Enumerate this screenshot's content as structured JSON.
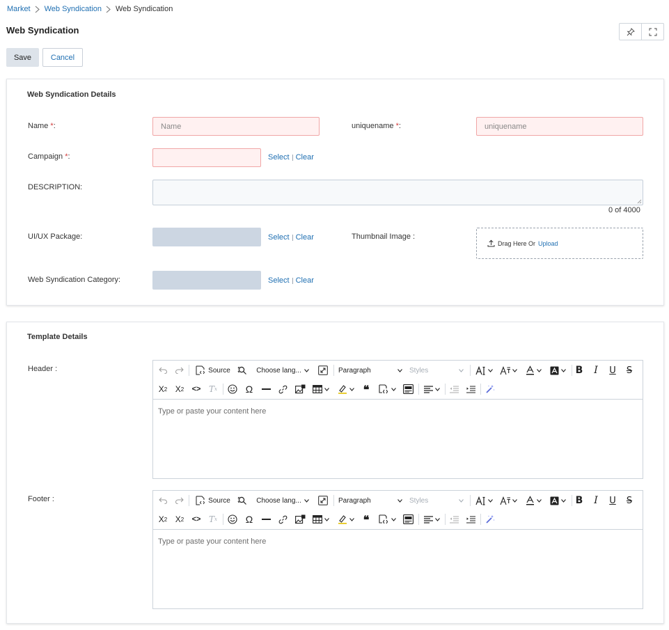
{
  "breadcrumb": {
    "items": [
      "Market",
      "Web Syndication"
    ],
    "current": "Web Syndication"
  },
  "page": {
    "title": "Web Syndication"
  },
  "header_icons": [
    "pin-icon",
    "fullscreen-icon"
  ],
  "actions": {
    "save_label": "Save",
    "cancel_label": "Cancel"
  },
  "details": {
    "title": "Web Syndication Details",
    "required_mark": "*",
    "name": {
      "label": "Name ",
      "suffix": ":",
      "placeholder": "Name"
    },
    "uniquename": {
      "label": "uniquename ",
      "suffix": ":",
      "placeholder": "uniquename"
    },
    "campaign": {
      "label": "Campaign ",
      "suffix": ":"
    },
    "description": {
      "label": "DESCRIPTION:",
      "counter": "0 of 4000"
    },
    "uiux_package": {
      "label": "UI/UX Package:"
    },
    "thumbnail": {
      "label": "Thumbnail Image :",
      "drag_text": "Drag Here Or",
      "upload_label": "Upload"
    },
    "category": {
      "label": "Web Syndication Category:"
    },
    "select_label": "Select",
    "clear_label": "Clear"
  },
  "template": {
    "title": "Template Details",
    "header_label": "Header :",
    "footer_label": "Footer :",
    "editor": {
      "source_label": "Source",
      "language_label": "Choose lang...",
      "paragraph_label": "Paragraph",
      "styles_label": "Styles",
      "placeholder": "Type or paste your content here"
    }
  },
  "colors": {
    "link": "#1f6fb2",
    "required": "#d23a3a",
    "invalid_bg": "#fff1f1",
    "invalid_border": "#f0a6a6",
    "readonly_bg": "#ccd6e2"
  }
}
